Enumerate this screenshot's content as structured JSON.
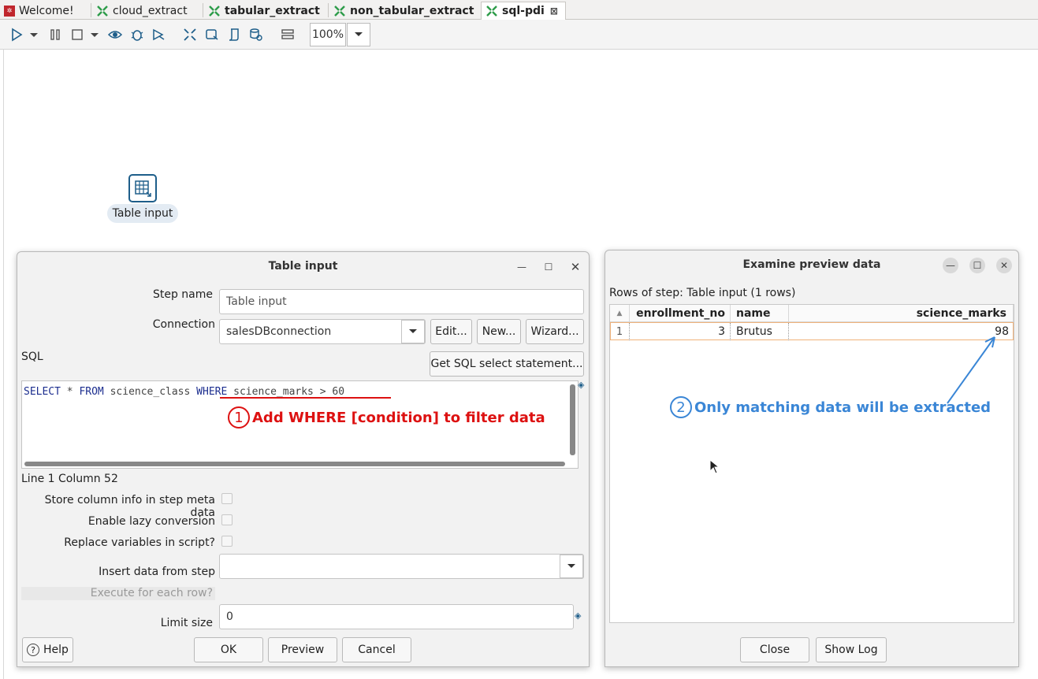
{
  "tabs": [
    {
      "label": "Welcome!",
      "icon": "welcome-icon"
    },
    {
      "label": "cloud_extract",
      "icon": "transformation-icon"
    },
    {
      "label": "tabular_extract",
      "icon": "transformation-icon"
    },
    {
      "label": "non_tabular_extract",
      "icon": "transformation-icon"
    },
    {
      "label": "sql-pdi",
      "icon": "transformation-icon"
    }
  ],
  "toolbar": {
    "zoom": "100%"
  },
  "canvas": {
    "step_label": "Table input"
  },
  "table_input": {
    "title": "Table input",
    "step_name_label": "Step name",
    "step_name_value": "Table input",
    "connection_label": "Connection",
    "connection_value": "salesDBconnection",
    "edit_label": "Edit...",
    "new_label": "New...",
    "wizard_label": "Wizard...",
    "sql_label": "SQL",
    "get_sql_label": "Get SQL select statement...",
    "sql": {
      "kw1": "SELECT",
      "p1": " * ",
      "kw2": "FROM",
      "p2": " science_class ",
      "kw3": "WHERE",
      "p3": " science_marks > 60"
    },
    "cursor_status": "Line 1 Column 52",
    "store_column_label": "Store column info in step meta data",
    "lazy_label": "Enable lazy conversion",
    "replace_vars_label": "Replace variables in script?",
    "insert_from_label": "Insert data from step",
    "insert_from_value": "",
    "execute_each_label": "Execute for each row?",
    "limit_label": "Limit size",
    "limit_value": "0",
    "help_label": "Help",
    "ok_label": "OK",
    "preview_label": "Preview",
    "cancel_label": "Cancel"
  },
  "annotations": {
    "a1_num": "1",
    "a1_text": "Add WHERE [condition] to filter data",
    "a2_num": "2",
    "a2_text": "Only matching data will be extracted"
  },
  "preview": {
    "title": "Examine preview data",
    "rows_info": "Rows of step: Table input (1 rows)",
    "columns": [
      "enrollment_no",
      "name",
      "science_marks"
    ],
    "rows": [
      {
        "num": "1",
        "enrollment_no": "3",
        "name": "Brutus",
        "science_marks": "98"
      }
    ],
    "close_label": "Close",
    "show_log_label": "Show Log"
  },
  "colors": {
    "annotation_red": "#dd1111",
    "annotation_blue": "#3a86d6",
    "keyword_blue": "#1c2e8f"
  }
}
